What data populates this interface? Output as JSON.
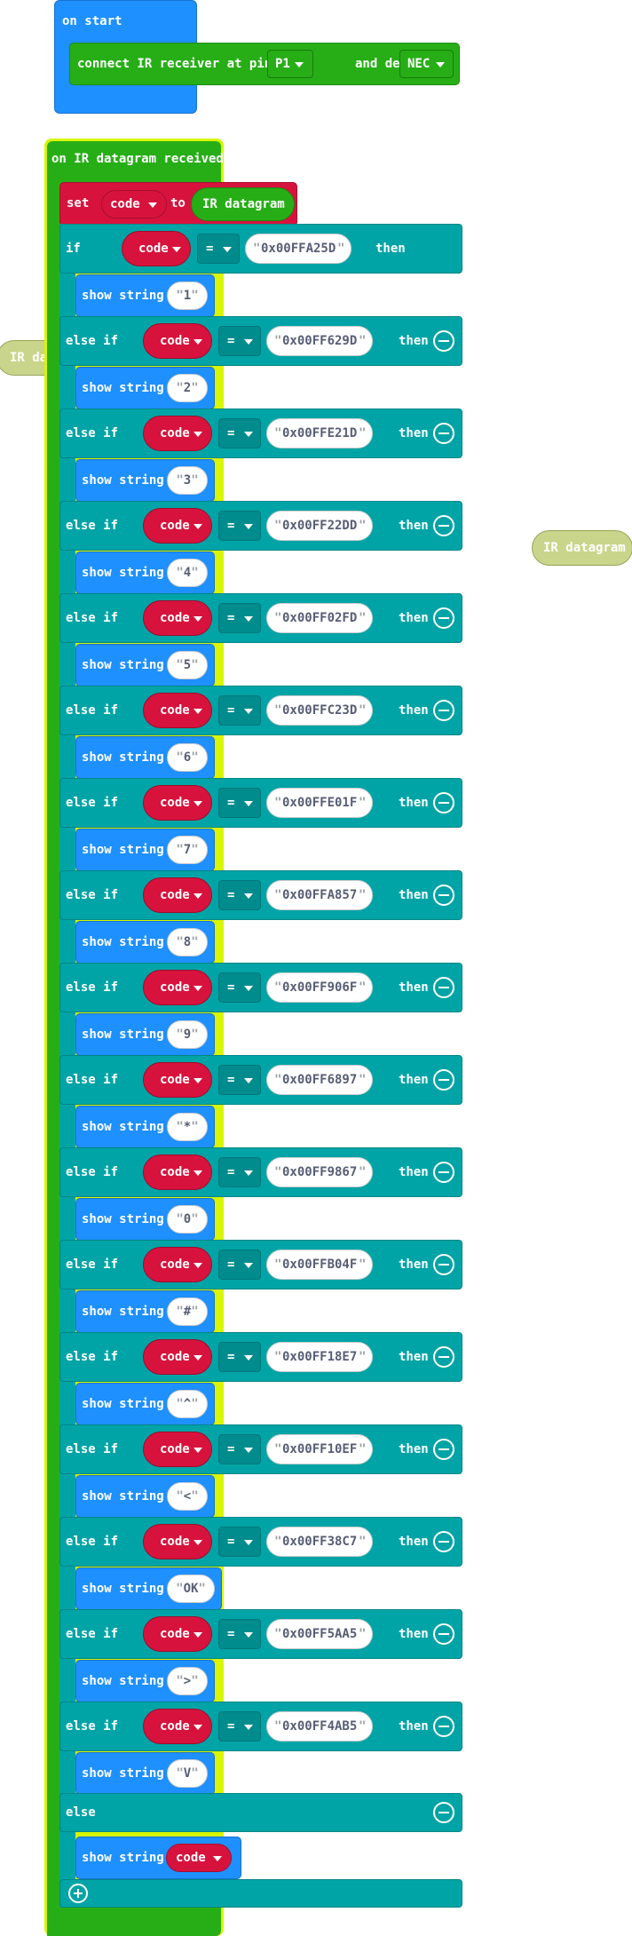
{
  "on_start": {
    "label": "on start",
    "connect_label": "connect IR receiver at pin",
    "pin": "P1",
    "decode_label": "and decode",
    "protocol": "NEC"
  },
  "event": {
    "label": "on IR datagram received",
    "set_label": "set",
    "var_name": "code",
    "to_label": "to",
    "value": "IR datagram"
  },
  "keywords": {
    "if": "if",
    "else_if": "else if",
    "else": "else",
    "then": "then",
    "operator": "=",
    "show_string": "show string"
  },
  "branches": [
    {
      "hex": "0x00FFA25D",
      "show": "1"
    },
    {
      "hex": "0x00FF629D",
      "show": "2"
    },
    {
      "hex": "0x00FFE21D",
      "show": "3"
    },
    {
      "hex": "0x00FF22DD",
      "show": "4"
    },
    {
      "hex": "0x00FF02FD",
      "show": "5"
    },
    {
      "hex": "0x00FFC23D",
      "show": "6"
    },
    {
      "hex": "0x00FFE01F",
      "show": "7"
    },
    {
      "hex": "0x00FFA857",
      "show": "8"
    },
    {
      "hex": "0x00FF906F",
      "show": "9"
    },
    {
      "hex": "0x00FF6897",
      "show": "*"
    },
    {
      "hex": "0x00FF9867",
      "show": "0"
    },
    {
      "hex": "0x00FFB04F",
      "show": "#"
    },
    {
      "hex": "0x00FF18E7",
      "show": "^"
    },
    {
      "hex": "0x00FF10EF",
      "show": "<"
    },
    {
      "hex": "0x00FF38C7",
      "show": "OK"
    },
    {
      "hex": "0x00FF5AA5",
      "show": ">"
    },
    {
      "hex": "0x00FF4AB5",
      "show": "V"
    }
  ],
  "else_show_var": "code",
  "floating": {
    "left_label": "IR da",
    "right_label": "IR datagram"
  },
  "colors": {
    "events": "#1e90ff",
    "infrared": "#27ae17",
    "variables": "#d7133d",
    "logic": "#00a4a6",
    "highlight": "#d9f500",
    "disabled": "#c9d58a"
  }
}
